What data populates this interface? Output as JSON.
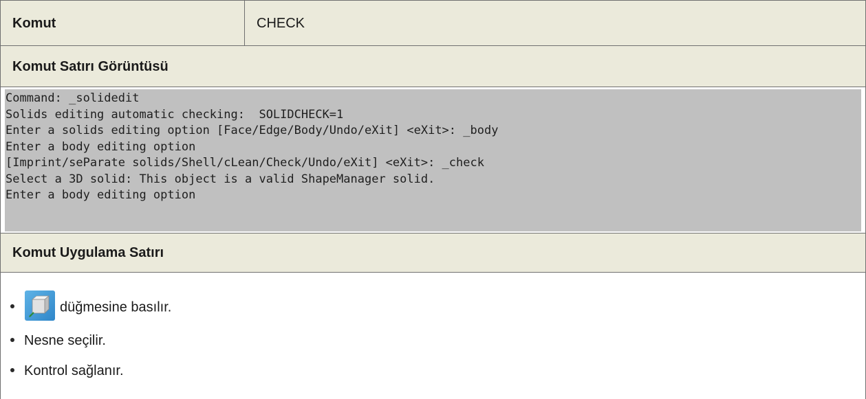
{
  "header": {
    "label": "Komut",
    "value": "CHECK"
  },
  "command_line_section": {
    "title": "Komut Satırı Görüntüsü",
    "lines": [
      "Command: _solidedit",
      "Solids editing automatic checking:  SOLIDCHECK=1",
      "Enter a solids editing option [Face/Edge/Body/Undo/eXit] <eXit>: _body",
      "Enter a body editing option",
      "[Imprint/seParate solids/Shell/cLean/Check/Undo/eXit] <eXit>: _check",
      "Select a 3D solid: This object is a valid ShapeManager solid.",
      "Enter a body editing option"
    ]
  },
  "application_section": {
    "title": "Komut Uygulama Satırı",
    "steps": [
      {
        "icon": "check-solid-cube-icon",
        "text": "düğmesine basılır."
      },
      {
        "text": "Nesne seçilir."
      },
      {
        "text": "Kontrol sağlanır."
      }
    ]
  },
  "colors": {
    "header_bg": "#ebeadb",
    "console_bg": "#c0c0c0",
    "border": "#6f6f6f"
  }
}
